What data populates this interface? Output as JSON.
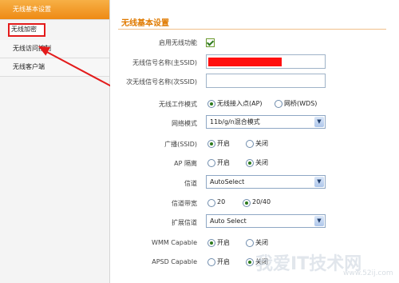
{
  "sidebar": {
    "items": [
      {
        "label": "无线基本设置"
      },
      {
        "label": "无线加密"
      },
      {
        "label": "无线访问控制"
      },
      {
        "label": "无线客户端"
      }
    ]
  },
  "main": {
    "title": "无线基本设置",
    "rows": {
      "enable": {
        "label": "启用无线功能",
        "checked": true
      },
      "ssid": {
        "label": "无线信号名称(主SSID)",
        "value": ""
      },
      "ssid2": {
        "label": "次无线信号名称(次SSID)",
        "value": ""
      },
      "mode": {
        "label": "无线工作模式",
        "opt1": "无线接入点(AP)",
        "opt2": "网桥(WDS)"
      },
      "network": {
        "label": "网络模式",
        "value": "11b/g/n混合模式"
      },
      "broadcast": {
        "label": "广播(SSID)",
        "on": "开启",
        "off": "关闭"
      },
      "ap_isolation": {
        "label": "AP 隔离",
        "on": "开启",
        "off": "关闭"
      },
      "channel": {
        "label": "信道",
        "value": "AutoSelect"
      },
      "bandwidth": {
        "label": "信道带宽",
        "opt1": "20",
        "opt2": "20/40"
      },
      "ext_channel": {
        "label": "扩展信道",
        "value": "Auto Select"
      },
      "wmm": {
        "label": "WMM Capable",
        "on": "开启",
        "off": "关闭"
      },
      "apsd": {
        "label": "APSD Capable",
        "on": "开启",
        "off": "关闭"
      }
    }
  },
  "watermark": {
    "text": "我爱IT技术网",
    "sub": "www.52ij.com"
  },
  "colors": {
    "accent": "#ee8a14",
    "highlight": "#e31b1b"
  }
}
